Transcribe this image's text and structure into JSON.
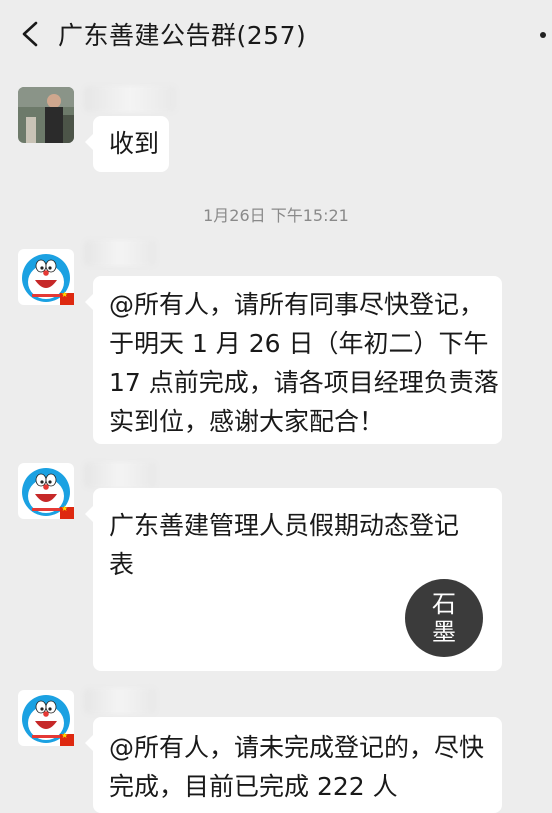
{
  "header": {
    "title": "广东善建公告群(257)",
    "back_icon": "chevron-left-icon",
    "more_icon": "more-icon"
  },
  "messages": [
    {
      "text": "收到"
    },
    {
      "timestamp": "1月26日 下午15:21"
    },
    {
      "lines": [
        "@所有人，请所有同事尽快登记，",
        "于明天 1 月 26 日（年初二）下午",
        "17 点前完成，请各项目经理负责落",
        "实到位，感谢大家配合！"
      ]
    },
    {
      "lines": [
        "广东善建管理人员假期动态登记",
        "表"
      ],
      "seal": [
        "石",
        "墨"
      ]
    },
    {
      "lines": [
        "@所有人，请未完成登记的，尽快",
        "完成，目前已完成 222 人"
      ]
    }
  ],
  "colors": {
    "background": "#ededed",
    "bubble": "#ffffff",
    "text": "#191919",
    "timestamp": "#8a8a8a"
  }
}
